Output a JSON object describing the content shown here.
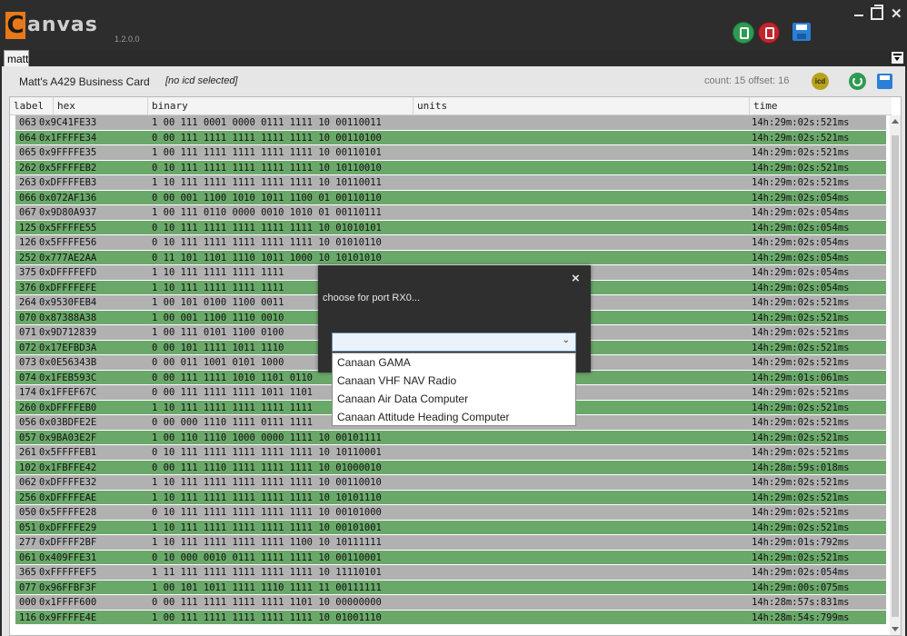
{
  "app": {
    "logo_first": "C",
    "logo_rest": "anvas",
    "version": "1.2.0.0",
    "window_controls": {
      "minimize": "minimize-icon",
      "restore": "restore-icon",
      "close": "✕"
    }
  },
  "tabs": [
    {
      "label": "matt"
    }
  ],
  "card": {
    "title": "Matt's A429 Business Card",
    "icd_status": "[no icd selected]",
    "counts": "count: 15  offset: 16",
    "icd_button": "icd"
  },
  "table": {
    "headers": [
      "label",
      "hex",
      "binary",
      "units",
      "time"
    ],
    "rows": [
      {
        "label": "063",
        "hex": "0x9C41FE33",
        "binary": "1 00 111 0001 0000 0111 1111 10 00110011",
        "time": "14h:29m:02s:521ms",
        "color": "gray"
      },
      {
        "label": "064",
        "hex": "0x1FFFFE34",
        "binary": "0 00 111 1111 1111 1111 1111 10 00110100",
        "time": "14h:29m:02s:521ms",
        "color": "green"
      },
      {
        "label": "065",
        "hex": "0x9FFFFE35",
        "binary": "1 00 111 1111 1111 1111 1111 10 00110101",
        "time": "14h:29m:02s:521ms",
        "color": "gray"
      },
      {
        "label": "262",
        "hex": "0x5FFFFEB2",
        "binary": "0 10 111 1111 1111 1111 1111 10 10110010",
        "time": "14h:29m:02s:521ms",
        "color": "green"
      },
      {
        "label": "263",
        "hex": "0xDFFFFEB3",
        "binary": "1 10 111 1111 1111 1111 1111 10 10110011",
        "time": "14h:29m:02s:521ms",
        "color": "gray"
      },
      {
        "label": "066",
        "hex": "0x072AF136",
        "binary": "0 00 001 1100 1010 1011 1100 01 00110110",
        "time": "14h:29m:02s:054ms",
        "color": "green"
      },
      {
        "label": "067",
        "hex": "0x9D80A937",
        "binary": "1 00 111 0110 0000 0010 1010 01 00110111",
        "time": "14h:29m:02s:054ms",
        "color": "gray"
      },
      {
        "label": "125",
        "hex": "0x5FFFFE55",
        "binary": "0 10 111 1111 1111 1111 1111 10 01010101",
        "time": "14h:29m:02s:054ms",
        "color": "green"
      },
      {
        "label": "126",
        "hex": "0x5FFFFE56",
        "binary": "0 10 111 1111 1111 1111 1111 10 01010110",
        "time": "14h:29m:02s:054ms",
        "color": "gray"
      },
      {
        "label": "252",
        "hex": "0x777AE2AA",
        "binary": "0 11 101 1101 1110 1011 1000 10 10101010",
        "time": "14h:29m:02s:054ms",
        "color": "green"
      },
      {
        "label": "375",
        "hex": "0xDFFFFEFD",
        "binary": "1 10 111 1111 1111 1111",
        "time": "14h:29m:02s:054ms",
        "color": "gray"
      },
      {
        "label": "376",
        "hex": "0xDFFFFEFE",
        "binary": "1 10 111 1111 1111 1111",
        "time": "14h:29m:02s:054ms",
        "color": "green"
      },
      {
        "label": "264",
        "hex": "0x9530FEB4",
        "binary": "1 00 101 0100 1100 0011",
        "time": "14h:29m:02s:521ms",
        "color": "gray"
      },
      {
        "label": "070",
        "hex": "0x87388A38",
        "binary": "1 00 001 1100 1110 0010",
        "time": "14h:29m:02s:521ms",
        "color": "green"
      },
      {
        "label": "071",
        "hex": "0x9D712839",
        "binary": "1 00 111 0101 1100 0100",
        "time": "14h:29m:02s:521ms",
        "color": "gray"
      },
      {
        "label": "072",
        "hex": "0x17EFBD3A",
        "binary": "0 00 101 1111 1011 1110",
        "time": "14h:29m:02s:521ms",
        "color": "green"
      },
      {
        "label": "073",
        "hex": "0x0E56343B",
        "binary": "0 00 011 1001 0101 1000",
        "time": "14h:29m:02s:521ms",
        "color": "gray"
      },
      {
        "label": "074",
        "hex": "0x1FEB593C",
        "binary": "0 00 111 1111 1010 1101 0110",
        "time": "14h:29m:01s:061ms",
        "color": "green"
      },
      {
        "label": "174",
        "hex": "0x1FFEF67C",
        "binary": "0 00 111 1111 1111 1011 1101",
        "time": "14h:29m:02s:521ms",
        "color": "gray"
      },
      {
        "label": "260",
        "hex": "0xDFFFFEB0",
        "binary": "1 10 111 1111 1111 1111 1111",
        "time": "14h:29m:02s:521ms",
        "color": "green"
      },
      {
        "label": "056",
        "hex": "0x03BDFE2E",
        "binary": "0 00 000 1110 1111 0111 1111",
        "time": "14h:29m:02s:521ms",
        "color": "gray"
      },
      {
        "label": "057",
        "hex": "0x9BA03E2F",
        "binary": "1 00 110 1110 1000 0000 1111 10 00101111",
        "time": "14h:29m:02s:521ms",
        "color": "green"
      },
      {
        "label": "261",
        "hex": "0x5FFFFEB1",
        "binary": "0 10 111 1111 1111 1111 1111 10 10110001",
        "time": "14h:29m:02s:521ms",
        "color": "gray"
      },
      {
        "label": "102",
        "hex": "0x1FBFFE42",
        "binary": "0 00 111 1110 1111 1111 1111 10 01000010",
        "time": "14h:28m:59s:018ms",
        "color": "green"
      },
      {
        "label": "062",
        "hex": "0xDFFFFE32",
        "binary": "1 10 111 1111 1111 1111 1111 10 00110010",
        "time": "14h:29m:02s:521ms",
        "color": "gray"
      },
      {
        "label": "256",
        "hex": "0xDFFFFEAE",
        "binary": "1 10 111 1111 1111 1111 1111 10 10101110",
        "time": "14h:29m:02s:521ms",
        "color": "green"
      },
      {
        "label": "050",
        "hex": "0x5FFFFE28",
        "binary": "0 10 111 1111 1111 1111 1111 10 00101000",
        "time": "14h:29m:02s:521ms",
        "color": "gray"
      },
      {
        "label": "051",
        "hex": "0xDFFFFE29",
        "binary": "1 10 111 1111 1111 1111 1111 10 00101001",
        "time": "14h:29m:02s:521ms",
        "color": "green"
      },
      {
        "label": "277",
        "hex": "0xDFFFF2BF",
        "binary": "1 10 111 1111 1111 1111 1100 10 10111111",
        "time": "14h:29m:01s:792ms",
        "color": "gray"
      },
      {
        "label": "061",
        "hex": "0x409FFE31",
        "binary": "0 10 000 0010 0111 1111 1111 10 00110001",
        "time": "14h:29m:02s:521ms",
        "color": "green"
      },
      {
        "label": "365",
        "hex": "0xFFFFFEF5",
        "binary": "1 11 111 1111 1111 1111 1111 10 11110101",
        "time": "14h:29m:02s:054ms",
        "color": "gray"
      },
      {
        "label": "077",
        "hex": "0x96FFBF3F",
        "binary": "1 00 101 1011 1111 1110 1111 11 00111111",
        "time": "14h:29m:00s:075ms",
        "color": "green"
      },
      {
        "label": "000",
        "hex": "0x1FFFF600",
        "binary": "0 00 111 1111 1111 1111 1101 10 00000000",
        "time": "14h:28m:57s:831ms",
        "color": "gray"
      },
      {
        "label": "116",
        "hex": "0x9FFFFE4E",
        "binary": "1 00 111 1111 1111 1111 1111 10 01001110",
        "time": "14h:28m:54s:799ms",
        "color": "green"
      }
    ]
  },
  "dialog": {
    "close": "×",
    "prompt": "choose for port RX0...",
    "selected": "",
    "chevron": "⌄",
    "options": [
      "Canaan GAMA",
      "Canaan VHF NAV Radio",
      "Canaan Air Data Computer",
      "Canaan Attitude Heading Computer"
    ]
  },
  "colors": {
    "row_gray": "#b1b1b1",
    "row_green": "#6aa86a",
    "accent_orange": "#e8791a"
  }
}
